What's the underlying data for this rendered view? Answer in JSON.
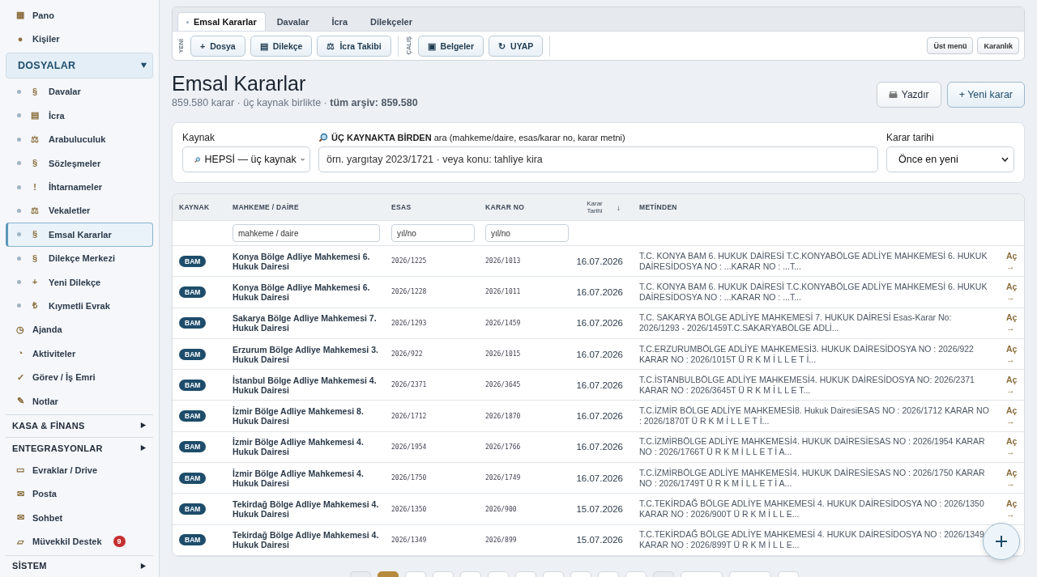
{
  "sidebar": {
    "items": [
      {
        "kind": "link",
        "glyph": "▦",
        "label": "Pano",
        "selected": false
      },
      {
        "kind": "link",
        "glyph": "●",
        "label": "Kişiler",
        "selected": false
      },
      {
        "kind": "section",
        "label": "DOSYALAR",
        "expanded": true,
        "selected": true,
        "children": [
          {
            "glyph": "§",
            "label": "Davalar",
            "selected": false
          },
          {
            "glyph": "▤",
            "label": "İcra",
            "selected": false
          },
          {
            "glyph": "⚖",
            "label": "Arabuluculuk",
            "selected": false
          },
          {
            "glyph": "§",
            "label": "Sözleşmeler",
            "selected": false
          },
          {
            "glyph": "!",
            "label": "İhtarnameler",
            "selected": false
          },
          {
            "glyph": "⚖",
            "label": "Vekaletler",
            "selected": false
          },
          {
            "glyph": "§",
            "label": "Emsal Kararlar",
            "selected": true
          },
          {
            "glyph": "§",
            "label": "Dilekçe Merkezi",
            "selected": false
          },
          {
            "glyph": "+",
            "label": "Yeni Dilekçe",
            "selected": false
          },
          {
            "glyph": "₺",
            "label": "Kıymetli Evrak",
            "selected": false
          }
        ]
      },
      {
        "kind": "link",
        "glyph": "◷",
        "label": "Ajanda",
        "selected": false
      },
      {
        "kind": "link",
        "glyph": "◔",
        "label": "Aktiviteler",
        "selected": false
      },
      {
        "kind": "link",
        "glyph": "✓",
        "label": "Görev / İş Emri",
        "selected": false
      },
      {
        "kind": "link",
        "glyph": "✎",
        "label": "Notlar",
        "selected": false
      },
      {
        "kind": "section",
        "label": "KASA & FİNANS",
        "expanded": false,
        "selected": false
      },
      {
        "kind": "section",
        "label": "ENTEGRASYONLAR",
        "expanded": false,
        "selected": false
      },
      {
        "kind": "link",
        "glyph": "▭",
        "label": "Evraklar / Drive",
        "selected": false
      },
      {
        "kind": "link",
        "glyph": "✉",
        "label": "Posta",
        "selected": false
      },
      {
        "kind": "link",
        "glyph": "✉",
        "label": "Sohbet",
        "selected": false
      },
      {
        "kind": "link",
        "glyph": "▱",
        "label": "Müvekkil Destek",
        "selected": false,
        "badge": "9"
      },
      {
        "kind": "section",
        "label": "SİSTEM",
        "expanded": false,
        "selected": false
      }
    ]
  },
  "tabs": [
    {
      "label": "Emsal Kararlar",
      "selected": true
    },
    {
      "label": "Davalar",
      "selected": false
    },
    {
      "label": "İcra",
      "selected": false
    },
    {
      "label": "Dilekçeler",
      "selected": false
    }
  ],
  "toolbar": {
    "groups": [
      {
        "label": "YENİ",
        "buttons": [
          {
            "glyph": "+",
            "label": "Dosya"
          },
          {
            "glyph": "▤",
            "label": "Dilekçe"
          },
          {
            "glyph": "⚖",
            "label": "İcra Takibi"
          }
        ]
      },
      {
        "label": "ÇALIŞ",
        "buttons": [
          {
            "glyph": "▣",
            "label": "Belgeler"
          },
          {
            "glyph": "↻",
            "label": "UYAP"
          }
        ]
      }
    ],
    "right_buttons": [
      "Üst menü",
      "Karanlık"
    ]
  },
  "page": {
    "title": "Emsal Kararlar",
    "subtitle": "859.580 karar · üç kaynak birlikte · **tüm arşiv: 859.580**",
    "print_button": "Yazdır",
    "new_button": "+ Yeni karar"
  },
  "filters": {
    "source_label": "Kaynak",
    "source_value": "HEPSİ — üç kaynak",
    "search_label": "**ÜÇ KAYNAKTA BİRDEN** ara (mahkeme/daire, esas/karar no, karar metni)",
    "search_placeholder": "örn. yargıtay 2023/1721 · veya konu: tahliye kira",
    "date_label": "Karar tarihi",
    "date_value": "Önce en yeni"
  },
  "table": {
    "columns": [
      "KAYNAK",
      "MAHKEME / DAİRE",
      "ESAS",
      "KARAR NO",
      "Karar Tarihi",
      "METİNDEN"
    ],
    "sort_glyph": "↓",
    "column_filters": [
      {
        "placeholder": "mahkeme / daire"
      },
      {
        "placeholder": "yıl/no"
      },
      {
        "placeholder": "yıl/no"
      }
    ],
    "rows": [
      {
        "source": "BAM",
        "court": "Konya Bölge Adliye Mahkemesi 6. Hukuk Dairesi",
        "esas": "2026/1225",
        "karar": "2026/1013",
        "date": "16.07.2026",
        "excerpt": "T.C. KONYA BAM 6. HUKUK DAİRESİ T.C.KONYABÖLGE ADLİYE MAHKEMESİ 6. HUKUK DAİRESİDOSYA NO : ...KARAR NO : ...T...",
        "action": "Aç →"
      },
      {
        "source": "BAM",
        "court": "Konya Bölge Adliye Mahkemesi 6. Hukuk Dairesi",
        "esas": "2026/1228",
        "karar": "2026/1011",
        "date": "16.07.2026",
        "excerpt": "T.C. KONYA BAM 6. HUKUK DAİRESİ T.C.KONYABÖLGE ADLİYE MAHKEMESİ 6. HUKUK DAİRESİDOSYA NO : ...KARAR NO : ...T...",
        "action": "Aç →"
      },
      {
        "source": "BAM",
        "court": "Sakarya Bölge Adliye Mahkemesi 7. Hukuk Dairesi",
        "esas": "2026/1293",
        "karar": "2026/1459",
        "date": "16.07.2026",
        "excerpt": "T.C. SAKARYA BÖLGE ADLİYE MAHKEMESİ 7. HUKUK DAİRESİ Esas-Karar No: 2026/1293 - 2026/1459T.C.SAKARYABÖLGE ADLİ...",
        "action": "Aç →"
      },
      {
        "source": "BAM",
        "court": "Erzurum Bölge Adliye Mahkemesi 3. Hukuk Dairesi",
        "esas": "2026/922",
        "karar": "2026/1015",
        "date": "16.07.2026",
        "excerpt": "T.C.ERZURUMBÖLGE ADLİYE MAHKEMESİ3. HUKUK DAİRESİDOSYA NO : 2026/922 KARAR NO : 2026/1015T Ü R K M İ L L E T İ...",
        "action": "Aç →"
      },
      {
        "source": "BAM",
        "court": "İstanbul Bölge Adliye Mahkemesi 4. Hukuk Dairesi",
        "esas": "2026/2371",
        "karar": "2026/3645",
        "date": "16.07.2026",
        "excerpt": "T.C.İSTANBULBÖLGE ADLİYE MAHKEMESİ4. HUKUK DAİRESİDOSYA NO: 2026/2371 KARAR NO : 2026/3645T Ü R K M İ L L E T...",
        "action": "Aç →"
      },
      {
        "source": "BAM",
        "court": "İzmir Bölge Adliye Mahkemesi 8. Hukuk Dairesi",
        "esas": "2026/1712",
        "karar": "2026/1870",
        "date": "16.07.2026",
        "excerpt": "T.C.İZMİR BÖLGE ADLİYE MAHKEMESİ8. Hukuk DairesiESAS NO : 2026/1712 KARAR NO : 2026/1870T Ü R K M İ L L E T İ...",
        "action": "Aç →"
      },
      {
        "source": "BAM",
        "court": "İzmir Bölge Adliye Mahkemesi 4. Hukuk Dairesi",
        "esas": "2026/1954",
        "karar": "2026/1766",
        "date": "16.07.2026",
        "excerpt": "T.C.İZMİRBÖLGE ADLİYE MAHKEMESİ4. HUKUK DAİRESİESAS NO : 2026/1954 KARAR NO : 2026/1766T Ü R K M İ L L E T İ A...",
        "action": "Aç →"
      },
      {
        "source": "BAM",
        "court": "İzmir Bölge Adliye Mahkemesi 4. Hukuk Dairesi",
        "esas": "2026/1750",
        "karar": "2026/1749",
        "date": "16.07.2026",
        "excerpt": "T.C.İZMİRBÖLGE ADLİYE MAHKEMESİ4. HUKUK DAİRESİESAS NO : 2026/1750 KARAR NO : 2026/1749T Ü R K M İ L L E T İ A...",
        "action": "Aç →"
      },
      {
        "source": "BAM",
        "court": "Tekirdağ Bölge Adliye Mahkemesi 4. Hukuk Dairesi",
        "esas": "2026/1350",
        "karar": "2026/900",
        "date": "15.07.2026",
        "excerpt": "T.C.TEKİRDAĞ BÖLGE ADLİYE MAHKEMESİ 4. HUKUK DAİRESİDOSYA NO : 2026/1350 KARAR NO : 2026/900T Ü R K M İ L L E...",
        "action": "Aç →"
      },
      {
        "source": "BAM",
        "court": "Tekirdağ Bölge Adliye Mahkemesi 4. Hukuk Dairesi",
        "esas": "2026/1349",
        "karar": "2026/899",
        "date": "15.07.2026",
        "excerpt": "T.C.TEKİRDAĞ BÖLGE ADLİYE MAHKEMESİ 4. HUKUK DAİRESİDOSYA NO : 2026/1349 KARAR NO : 2026/899T Ü R K M İ L L E..."
      }
    ]
  },
  "pagination": [
    {
      "kind": "arrow",
      "selected": false
    },
    {
      "kind": "page",
      "selected": true
    },
    {
      "kind": "page",
      "selected": false
    },
    {
      "kind": "page",
      "selected": false
    },
    {
      "kind": "page",
      "selected": false
    },
    {
      "kind": "page",
      "selected": false
    },
    {
      "kind": "page",
      "selected": false
    },
    {
      "kind": "page",
      "selected": false
    },
    {
      "kind": "page",
      "selected": false
    },
    {
      "kind": "page",
      "selected": false
    },
    {
      "kind": "page",
      "selected": false
    },
    {
      "kind": "gap",
      "selected": false
    },
    {
      "kind": "wide",
      "selected": false
    },
    {
      "kind": "wide",
      "selected": false
    },
    {
      "kind": "arrow",
      "selected": false
    }
  ]
}
